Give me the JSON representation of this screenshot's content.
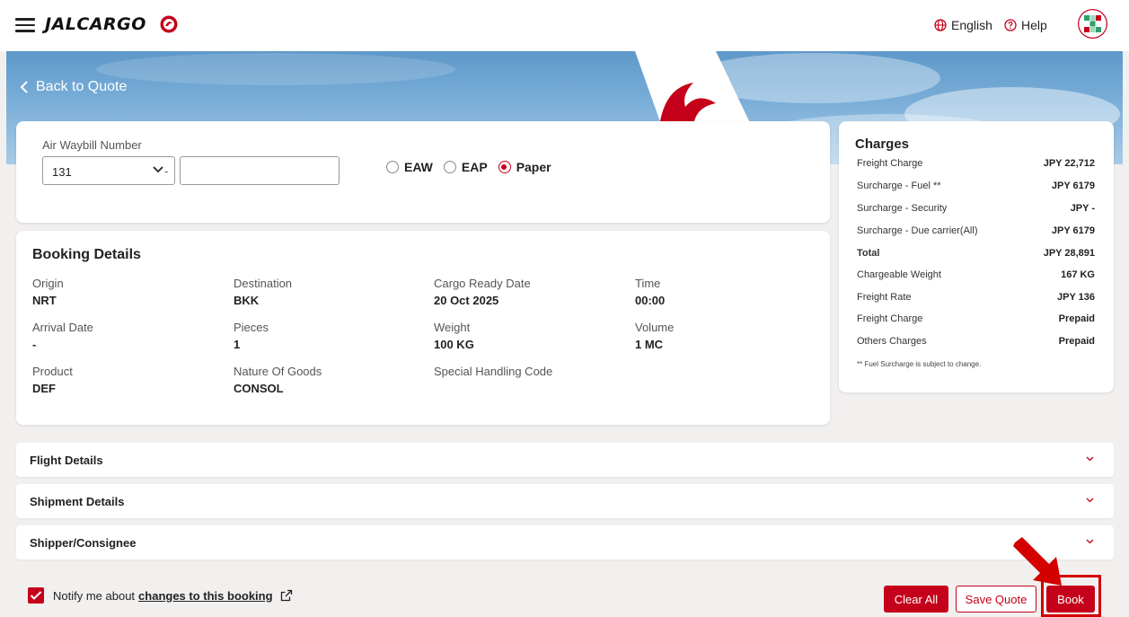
{
  "header": {
    "brand": "JALCARGO",
    "language_label": "English",
    "help_label": "Help"
  },
  "hero": {
    "back_label": "Back to Quote"
  },
  "awb": {
    "label": "Air Waybill Number",
    "prefix_value": "131",
    "separator": "-",
    "number_value": "",
    "options": [
      {
        "label": "EAW",
        "selected": false
      },
      {
        "label": "EAP",
        "selected": false
      },
      {
        "label": "Paper",
        "selected": true
      }
    ]
  },
  "booking": {
    "title": "Booking Details",
    "fields": [
      {
        "label": "Origin",
        "value": "NRT"
      },
      {
        "label": "Destination",
        "value": "BKK"
      },
      {
        "label": "Cargo Ready Date",
        "value": "20 Oct 2025"
      },
      {
        "label": "Time",
        "value": "00:00"
      },
      {
        "label": "Arrival Date",
        "value": "-"
      },
      {
        "label": "Pieces",
        "value": "1"
      },
      {
        "label": "Weight",
        "value": "100 KG"
      },
      {
        "label": "Volume",
        "value": "1 MC"
      },
      {
        "label": "Product",
        "value": "DEF"
      },
      {
        "label": "Nature Of Goods",
        "value": "CONSOL"
      },
      {
        "label": "Special Handling Code",
        "value": ""
      }
    ]
  },
  "charges": {
    "title": "Charges",
    "rows": [
      {
        "label": "Freight Charge",
        "value": "JPY 22,712"
      },
      {
        "label": "Surcharge - Fuel **",
        "value": "JPY 6179"
      },
      {
        "label": "Surcharge - Security",
        "value": "JPY -"
      },
      {
        "label": "Surcharge - Due carrier(All)",
        "value": "JPY 6179"
      },
      {
        "label": "Total",
        "value": "JPY 28,891"
      },
      {
        "label": "Chargeable Weight",
        "value": "167 KG"
      },
      {
        "label": "Freight Rate",
        "value": "JPY 136"
      },
      {
        "label": "Freight Charge",
        "value": "Prepaid"
      },
      {
        "label": "Others Charges",
        "value": "Prepaid"
      }
    ],
    "note": "** Fuel Surcharge is subject to change."
  },
  "sections": [
    {
      "title": "Flight Details"
    },
    {
      "title": "Shipment Details"
    },
    {
      "title": "Shipper/Consignee"
    }
  ],
  "notify": {
    "prefix": "Notify me about",
    "link": "changes to this booking",
    "checked": true
  },
  "actions": {
    "clear_all": "Clear All",
    "save_quote": "Save Quote",
    "book": "Book"
  },
  "colors": {
    "brand_red": "#c4001a",
    "background": "#f2f0ef"
  }
}
